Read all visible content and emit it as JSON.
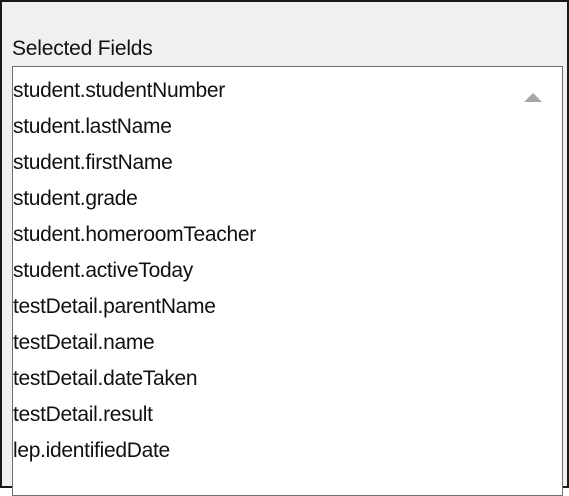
{
  "panel": {
    "label": "Selected Fields"
  },
  "fields": [
    "student.studentNumber",
    "student.lastName",
    "student.firstName",
    "student.grade",
    "student.homeroomTeacher",
    "student.activeToday",
    "testDetail.parentName",
    "testDetail.name",
    "testDetail.dateTaken",
    "testDetail.result",
    "lep.identifiedDate"
  ],
  "icons": {
    "scroll_up": "scroll-up-arrow-icon"
  },
  "colors": {
    "frame_border": "#1a1a1a",
    "panel_bg": "#f0f0f0",
    "list_bg": "#ffffff",
    "list_border": "#6f6f6f",
    "scroll_arrow": "#a6a6a6"
  }
}
